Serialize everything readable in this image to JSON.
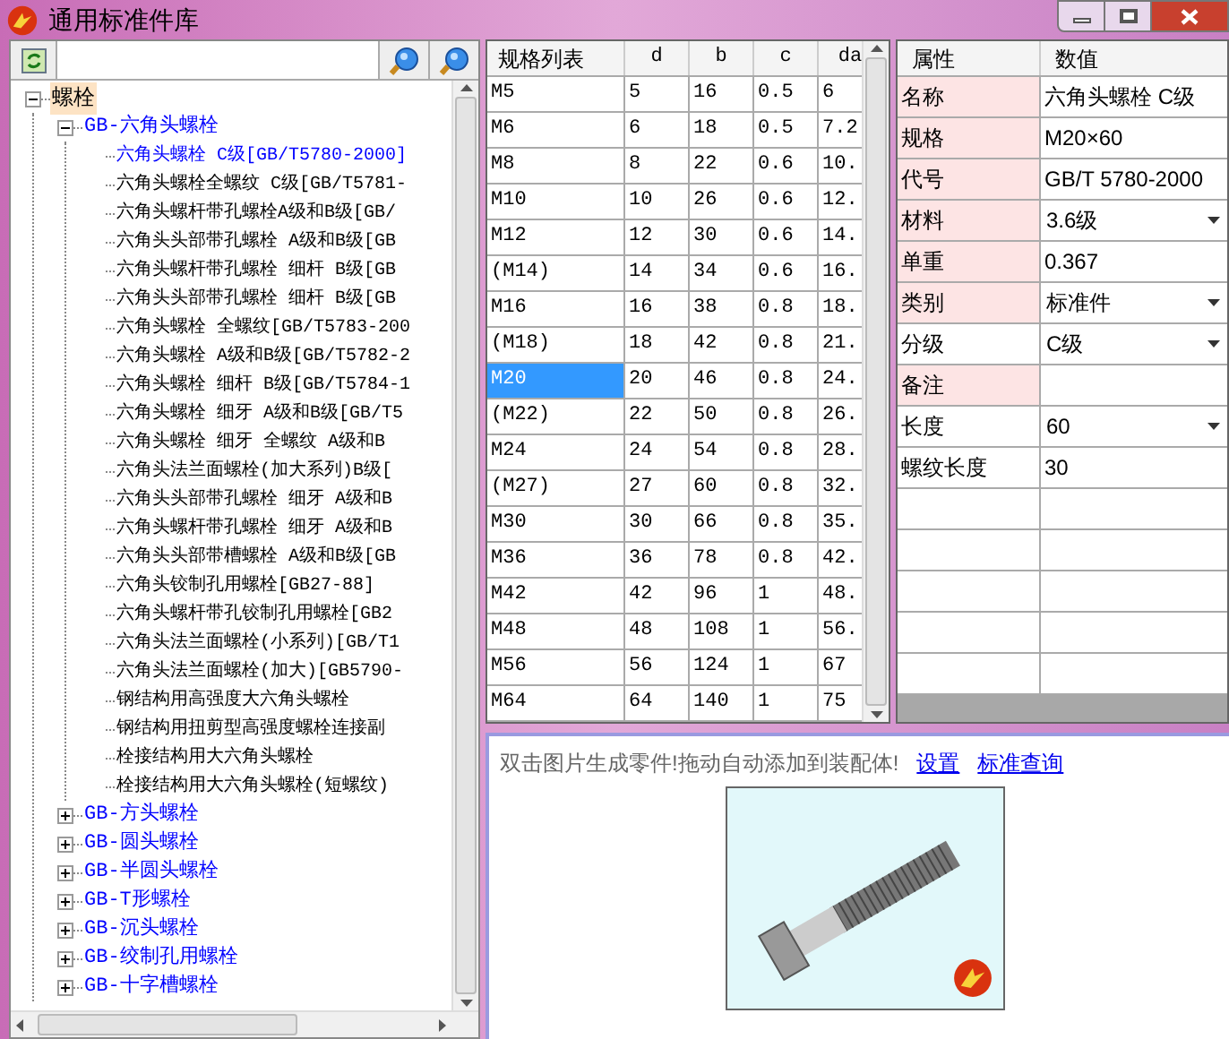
{
  "window": {
    "title": "通用标准件库"
  },
  "tree": [
    {
      "label": "螺栓",
      "selected": true,
      "expanded": true,
      "children": [
        {
          "label": "GB-六角头螺栓",
          "selected": false,
          "expanded": true,
          "children": [
            {
              "label": "六角头螺栓 C级[GB/T5780-2000]",
              "selected": false,
              "active": true
            },
            {
              "label": "六角头螺栓全螺纹 C级[GB/T5781-",
              "selected": false,
              "active": false
            },
            {
              "label": "六角头螺杆带孔螺栓A级和B级[GB/",
              "selected": false,
              "active": false
            },
            {
              "label": "六角头头部带孔螺栓 A级和B级[GB",
              "selected": false,
              "active": false
            },
            {
              "label": "六角头螺杆带孔螺栓 细杆 B级[GB",
              "selected": false,
              "active": false
            },
            {
              "label": "六角头头部带孔螺栓 细杆 B级[GB",
              "selected": false,
              "active": false
            },
            {
              "label": "六角头螺栓 全螺纹[GB/T5783-200",
              "selected": false,
              "active": false
            },
            {
              "label": "六角头螺栓 A级和B级[GB/T5782-2",
              "selected": false,
              "active": false
            },
            {
              "label": "六角头螺栓 细杆 B级[GB/T5784-1",
              "selected": false,
              "active": false
            },
            {
              "label": "六角头螺栓 细牙 A级和B级[GB/T5",
              "selected": false,
              "active": false
            },
            {
              "label": "六角头螺栓 细牙 全螺纹 A级和B",
              "selected": false,
              "active": false
            },
            {
              "label": "六角头法兰面螺栓(加大系列)B级[",
              "selected": false,
              "active": false
            },
            {
              "label": "六角头头部带孔螺栓 细牙 A级和B",
              "selected": false,
              "active": false
            },
            {
              "label": "六角头螺杆带孔螺栓 细牙 A级和B",
              "selected": false,
              "active": false
            },
            {
              "label": "六角头头部带槽螺栓 A级和B级[GB",
              "selected": false,
              "active": false
            },
            {
              "label": "六角头铰制孔用螺栓[GB27-88]",
              "selected": false,
              "active": false
            },
            {
              "label": "六角头螺杆带孔铰制孔用螺栓[GB2",
              "selected": false,
              "active": false
            },
            {
              "label": "六角头法兰面螺栓(小系列)[GB/T1",
              "selected": false,
              "active": false
            },
            {
              "label": "六角头法兰面螺栓(加大)[GB5790-",
              "selected": false,
              "active": false
            },
            {
              "label": "钢结构用高强度大六角头螺栓",
              "selected": false,
              "active": false
            },
            {
              "label": "钢结构用扭剪型高强度螺栓连接副",
              "selected": false,
              "active": false
            },
            {
              "label": "栓接结构用大六角头螺栓",
              "selected": false,
              "active": false
            },
            {
              "label": "栓接结构用大六角头螺栓(短螺纹)",
              "selected": false,
              "active": false
            }
          ]
        },
        {
          "label": "GB-方头螺栓",
          "selected": false,
          "expanded": false
        },
        {
          "label": "GB-圆头螺栓",
          "selected": false,
          "expanded": false
        },
        {
          "label": "GB-半圆头螺栓",
          "selected": false,
          "expanded": false
        },
        {
          "label": "GB-T形螺栓",
          "selected": false,
          "expanded": false
        },
        {
          "label": "GB-沉头螺栓",
          "selected": false,
          "expanded": false
        },
        {
          "label": "GB-绞制孔用螺栓",
          "selected": false,
          "expanded": false
        },
        {
          "label": "GB-十字槽螺栓",
          "selected": false,
          "expanded": false
        }
      ]
    }
  ],
  "spec_table": {
    "columns": [
      "规格列表",
      "d",
      "b",
      "c",
      "da"
    ],
    "rows": [
      {
        "cells": [
          "M5",
          "5",
          "16",
          "0.5",
          "6"
        ],
        "selected": false
      },
      {
        "cells": [
          "M6",
          "6",
          "18",
          "0.5",
          "7.2"
        ],
        "selected": false
      },
      {
        "cells": [
          "M8",
          "8",
          "22",
          "0.6",
          "10."
        ],
        "selected": false
      },
      {
        "cells": [
          "M10",
          "10",
          "26",
          "0.6",
          "12."
        ],
        "selected": false
      },
      {
        "cells": [
          "M12",
          "12",
          "30",
          "0.6",
          "14."
        ],
        "selected": false
      },
      {
        "cells": [
          "(M14)",
          "14",
          "34",
          "0.6",
          "16."
        ],
        "selected": false
      },
      {
        "cells": [
          "M16",
          "16",
          "38",
          "0.8",
          "18."
        ],
        "selected": false
      },
      {
        "cells": [
          "(M18)",
          "18",
          "42",
          "0.8",
          "21."
        ],
        "selected": false
      },
      {
        "cells": [
          "M20",
          "20",
          "46",
          "0.8",
          "24."
        ],
        "selected": true
      },
      {
        "cells": [
          "(M22)",
          "22",
          "50",
          "0.8",
          "26."
        ],
        "selected": false
      },
      {
        "cells": [
          "M24",
          "24",
          "54",
          "0.8",
          "28."
        ],
        "selected": false
      },
      {
        "cells": [
          "(M27)",
          "27",
          "60",
          "0.8",
          "32."
        ],
        "selected": false
      },
      {
        "cells": [
          "M30",
          "30",
          "66",
          "0.8",
          "35."
        ],
        "selected": false
      },
      {
        "cells": [
          "M36",
          "36",
          "78",
          "0.8",
          "42."
        ],
        "selected": false
      },
      {
        "cells": [
          "M42",
          "42",
          "96",
          "1",
          "48."
        ],
        "selected": false
      },
      {
        "cells": [
          "M48",
          "48",
          "108",
          "1",
          "56."
        ],
        "selected": false
      },
      {
        "cells": [
          "M56",
          "56",
          "124",
          "1",
          "67"
        ],
        "selected": false
      },
      {
        "cells": [
          "M64",
          "64",
          "140",
          "1",
          "75"
        ],
        "selected": false
      }
    ]
  },
  "properties": {
    "columns": [
      "属性",
      "数值"
    ],
    "rows": [
      {
        "name": "名称",
        "value": "六角头螺栓 C级",
        "kind": "text",
        "required": true
      },
      {
        "name": "规格",
        "value": "M20×60",
        "kind": "text",
        "required": true
      },
      {
        "name": "代号",
        "value": "GB/T 5780-2000",
        "kind": "text",
        "required": true
      },
      {
        "name": "材料",
        "value": "3.6级",
        "kind": "dropdown",
        "required": true
      },
      {
        "name": "单重",
        "value": "0.367",
        "kind": "text",
        "required": true
      },
      {
        "name": "类别",
        "value": "标准件",
        "kind": "dropdown",
        "required": true
      },
      {
        "name": "分级",
        "value": "C级",
        "kind": "dropdown",
        "required": false
      },
      {
        "name": "备注",
        "kind": "text",
        "required": true
      },
      {
        "name": "长度",
        "value": "60",
        "kind": "dropdown",
        "required": false
      },
      {
        "name": "螺纹长度",
        "value": "30",
        "kind": "input",
        "required": false
      }
    ]
  },
  "preview": {
    "hint": "双击图片生成零件!拖动自动添加到装配体!",
    "links": [
      "设置",
      "标准查询"
    ]
  }
}
